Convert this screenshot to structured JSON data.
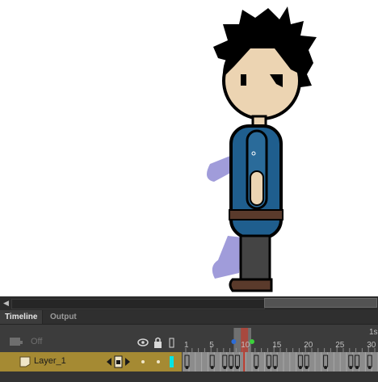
{
  "timeline": {
    "tabs": [
      "Timeline",
      "Output"
    ],
    "off_label": "Off",
    "frame_numbers": [
      "1",
      "5",
      "10",
      "15",
      "20",
      "25",
      "30"
    ],
    "seconds_marker": "1s",
    "current_frame": 10,
    "onion_skin_start": 9,
    "onion_skin_end": 11,
    "layer": {
      "name": "Layer_1",
      "color": "#00e5e5"
    },
    "keyframes": [
      1,
      5,
      7,
      8,
      9,
      12,
      14,
      15,
      19,
      20,
      23,
      27,
      28,
      30
    ]
  },
  "colors": {
    "layer_highlight": "#a58a33",
    "playhead": "#c0392b",
    "panel_bg": "#3c3c3c",
    "frames_bg": "#8c8c8c"
  },
  "icons": [
    "eye-icon",
    "lock-icon",
    "outline-icon",
    "layer-icon",
    "prev-key-icon",
    "add-key-icon",
    "next-key-icon"
  ]
}
